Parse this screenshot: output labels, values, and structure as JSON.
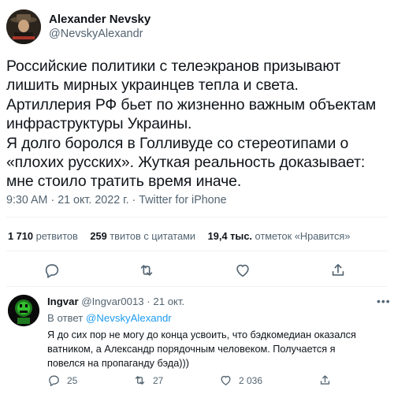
{
  "author": {
    "display_name": "Alexander Nevsky",
    "handle": "@NevskyAlexandr"
  },
  "tweet": {
    "lines": [
      "Российские политики с телеэкранов призывают",
      "лишить мирных украинцев тепла и света.",
      "Артиллерия РФ бьет по жизненно важным объектам",
      "инфраструктуры Украины.",
      "Я долго боролся в Голливуде со стереотипами о",
      "«плохих русских». Жуткая реальность доказывает:",
      "мне стоило тратить время иначе."
    ],
    "time": "9:30 AM",
    "sep1": " · ",
    "date": "21 окт. 2022 г.",
    "sep2": " · ",
    "source": "Twitter for iPhone"
  },
  "stats": {
    "retweets_count": "1 710",
    "retweets_label": " ретвитов",
    "quotes_count": "259",
    "quotes_label": " твитов с цитатами",
    "likes_count": "19,4 тыс.",
    "likes_label": " отметок «Нравится»"
  },
  "reply": {
    "name": "Ingvar",
    "handle": "@Ingvar0013",
    "sep": " · ",
    "date": "21 окт.",
    "reply_to_prefix": "В ответ ",
    "reply_to_handle": "@NevskyAlexandr",
    "text_lines": [
      "Я до сих пор не могу до конца усвоить, что бэдкомедиан оказался",
      "ватником, а Александр порядочным человеком. Получается я",
      "повелся на пропаганду бэда)))"
    ],
    "replies": "25",
    "retweets": "27",
    "likes": "2 036"
  },
  "icons": {
    "reply": "speech-bubble-icon",
    "retweet": "retweet-icon",
    "like": "heart-icon",
    "share": "share-icon",
    "more": "more-dots-icon"
  },
  "colors": {
    "text": "#0f1419",
    "muted": "#536471",
    "link": "#1d9bf0",
    "divider": "#eff3f4"
  }
}
